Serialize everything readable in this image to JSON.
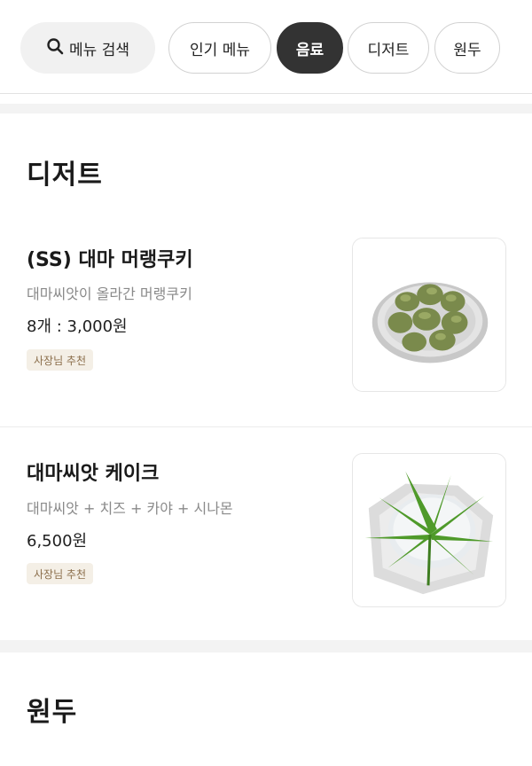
{
  "categories": {
    "search_label": "메뉴 검색",
    "tabs": [
      "인기 메뉴",
      "음료",
      "디저트",
      "원두"
    ],
    "active_tab": "음료"
  },
  "sections": [
    {
      "title": "디저트",
      "items": [
        {
          "name": "(SS) 대마 머랭쿠키",
          "description": "대마씨앗이 올라간 머랭쿠키",
          "price": "8개 : 3,000원",
          "badge": "사장님 추천"
        },
        {
          "name": "대마씨앗 케이크",
          "description": "대마씨앗 + 치즈 + 카야 + 시나몬",
          "price": "6,500원",
          "badge": "사장님 추천"
        }
      ]
    },
    {
      "title": "원두",
      "items": []
    }
  ],
  "colors": {
    "active_tab_bg": "#333333",
    "badge_bg": "#f4efe6",
    "badge_text": "#8a6d4a"
  }
}
